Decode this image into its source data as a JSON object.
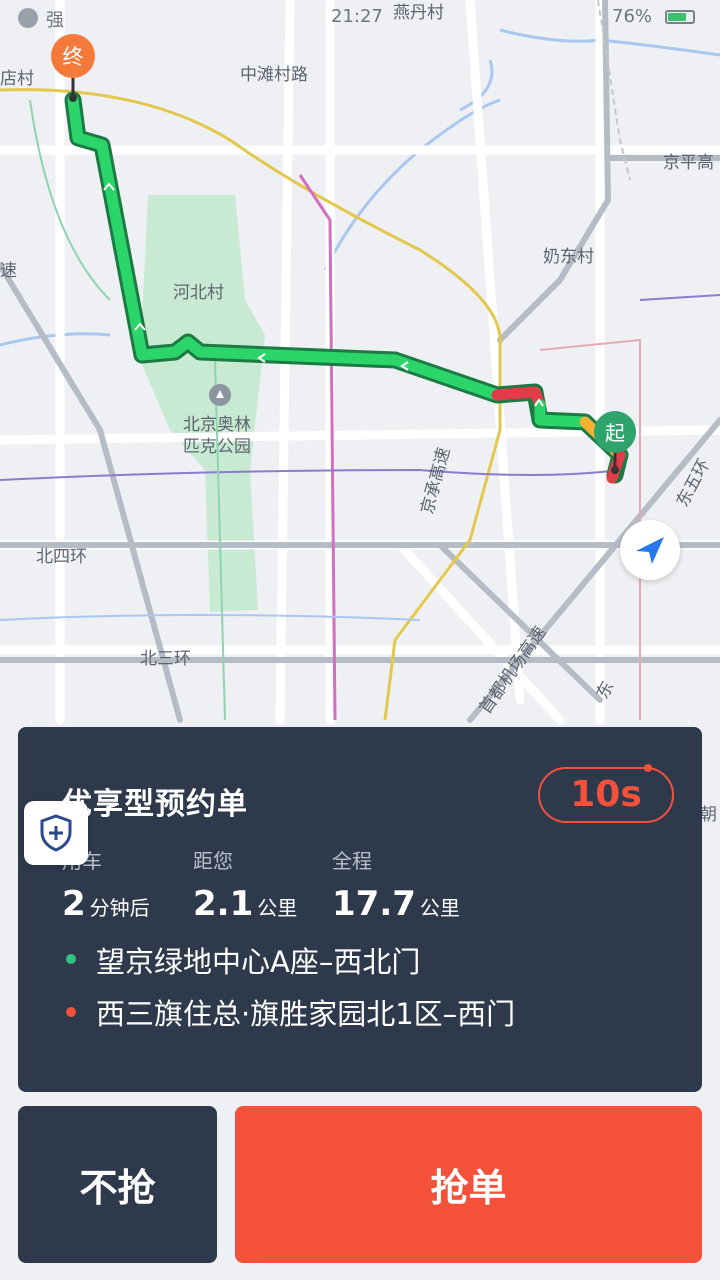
{
  "status_bar": {
    "signal": "强",
    "time": "21:27",
    "battery_pct": "76%",
    "battery_level": 0.76
  },
  "map": {
    "labels": {
      "yandancun": "燕丹村",
      "zhongtancunlu": "中滩村路",
      "jingpinggao": "京平高",
      "naidongcun": "奶东村",
      "hebeicun": "河北村",
      "olympic_park_1": "北京奥林",
      "olympic_park_2": "匹克公园",
      "beisihuan": "北四环",
      "beisanhuan": "北三环",
      "jingchenggaosu": "京承高速",
      "airport_expressway": "首都机场高速",
      "dongwuhuan": "东五环",
      "dong": "东",
      "diancun": "店村",
      "su": "速",
      "chao": "朝"
    },
    "end_marker": "终",
    "start_marker": "起"
  },
  "order": {
    "title": "优享型预约单",
    "countdown": "10s",
    "stats": [
      {
        "label": "用车",
        "value": "2",
        "unit": "分钟后"
      },
      {
        "label": "距您",
        "value": "2.1",
        "unit": "公里"
      },
      {
        "label": "全程",
        "value": "17.7",
        "unit": "公里"
      }
    ],
    "pickup": "望京绿地中心A座–西北门",
    "dropoff": "西三旗住总·旗胜家园北1区–西门",
    "colors": {
      "pickup_dot": "#2ec27e",
      "dropoff_dot": "#f4513a",
      "accent": "#f4513a",
      "card_bg": "#2e3a4c"
    }
  },
  "buttons": {
    "skip": "不抢",
    "grab": "抢单"
  },
  "icons": {
    "shield": "shield-plus-icon",
    "locate": "navigation-arrow-icon",
    "wifi": "wifi-icon",
    "battery": "battery-icon"
  }
}
